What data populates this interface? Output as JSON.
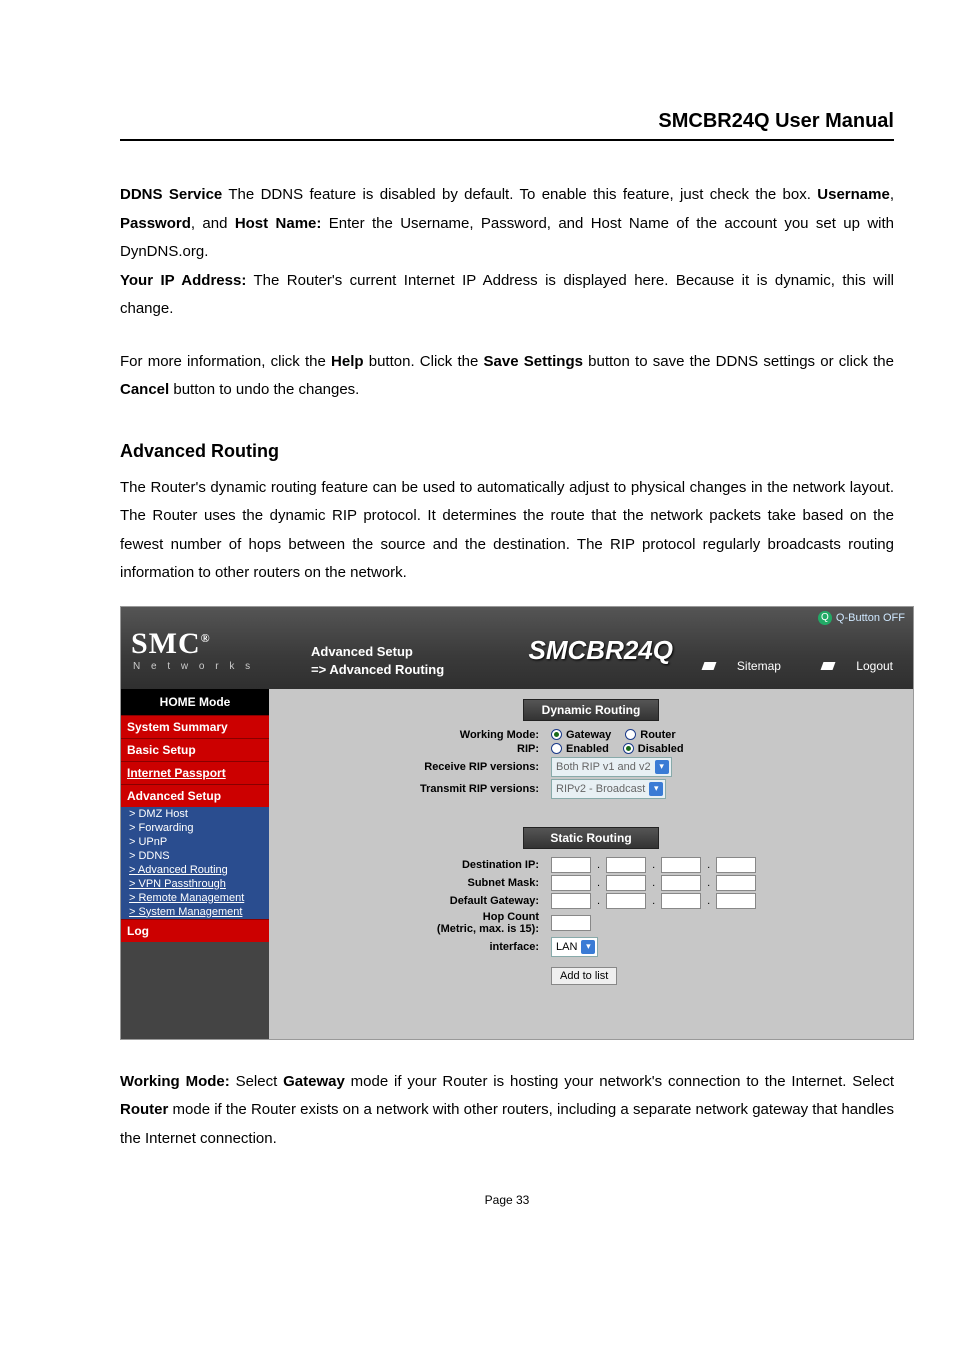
{
  "doc": {
    "header": "SMCBR24Q User Manual",
    "page_number": "Page 33",
    "para1_a": "DDNS Service",
    "para1_b": " The DDNS feature is disabled by default. To enable this feature, just check the box. ",
    "para1_c": "Username",
    "para1_d": ", ",
    "para1_e": "Password",
    "para1_f": ", and ",
    "para1_g": "Host Name:",
    "para1_h": " Enter the Username, Password, and Host Name of the account you set up with DynDNS.org.",
    "para2_a": "Your IP Address:",
    "para2_b": " The Router's current Internet IP Address is displayed here. Because it is dynamic, this will change.",
    "para3_a": "For more information, click the ",
    "para3_b": "Help",
    "para3_c": " button. Click the ",
    "para3_d": "Save Settings",
    "para3_e": " button to save the DDNS settings or click the ",
    "para3_f": "Cancel",
    "para3_g": " button to undo the changes.",
    "heading": "Advanced Routing",
    "para4": "The Router's dynamic routing feature can be used to automatically adjust to physical changes in the network layout. The Router uses the dynamic RIP protocol. It determines the route that the network packets take based on the fewest number of hops between the source and the destination. The RIP protocol regularly broadcasts routing information to other routers on the network.",
    "para5_a": "Working Mode:",
    "para5_b": " Select ",
    "para5_c": "Gateway",
    "para5_d": " mode if your Router is hosting your network's connection to the Internet. Select ",
    "para5_e": "Router",
    "para5_f": " mode if the Router exists on a network with other routers, including a separate network gateway that handles the Internet connection."
  },
  "ui": {
    "logo": "SMC",
    "logo_sup": "®",
    "logo_sub": "N e t w o r k s",
    "breadcrumb_l1": "Advanced Setup",
    "breadcrumb_l2": "=> Advanced Routing",
    "model": "SMCBR24Q",
    "qbutton_label": "Q-Button OFF",
    "qbutton_mark": "Q",
    "topnav": {
      "sitemap": "Sitemap",
      "logout": "Logout"
    },
    "sidebar": {
      "home": "HOME Mode",
      "sections": [
        "System Summary",
        "Basic Setup",
        "Internet Passport",
        "Advanced Setup"
      ],
      "subs": [
        "> DMZ Host",
        "> Forwarding",
        "> UPnP",
        "> DDNS",
        "> Advanced Routing",
        "> VPN Passthrough",
        "> Remote Management",
        "> System Management"
      ],
      "log": "Log"
    },
    "dynamic": {
      "title": "Dynamic Routing",
      "working_mode_label": "Working Mode:",
      "working_mode_opt1": "Gateway",
      "working_mode_opt2": "Router",
      "rip_label": "RIP:",
      "rip_opt1": "Enabled",
      "rip_opt2": "Disabled",
      "recv_label": "Receive RIP versions:",
      "recv_value": "Both RIP v1 and v2",
      "trans_label": "Transmit RIP versions:",
      "trans_value": "RIPv2 - Broadcast"
    },
    "staticr": {
      "title": "Static Routing",
      "dest_label": "Destination IP:",
      "mask_label": "Subnet Mask:",
      "gw_label": "Default Gateway:",
      "hop_label1": "Hop Count",
      "hop_label2": "(Metric, max. is 15):",
      "iface_label": "interface:",
      "iface_value": "LAN",
      "add_btn": "Add to list"
    }
  },
  "chart_data": null
}
